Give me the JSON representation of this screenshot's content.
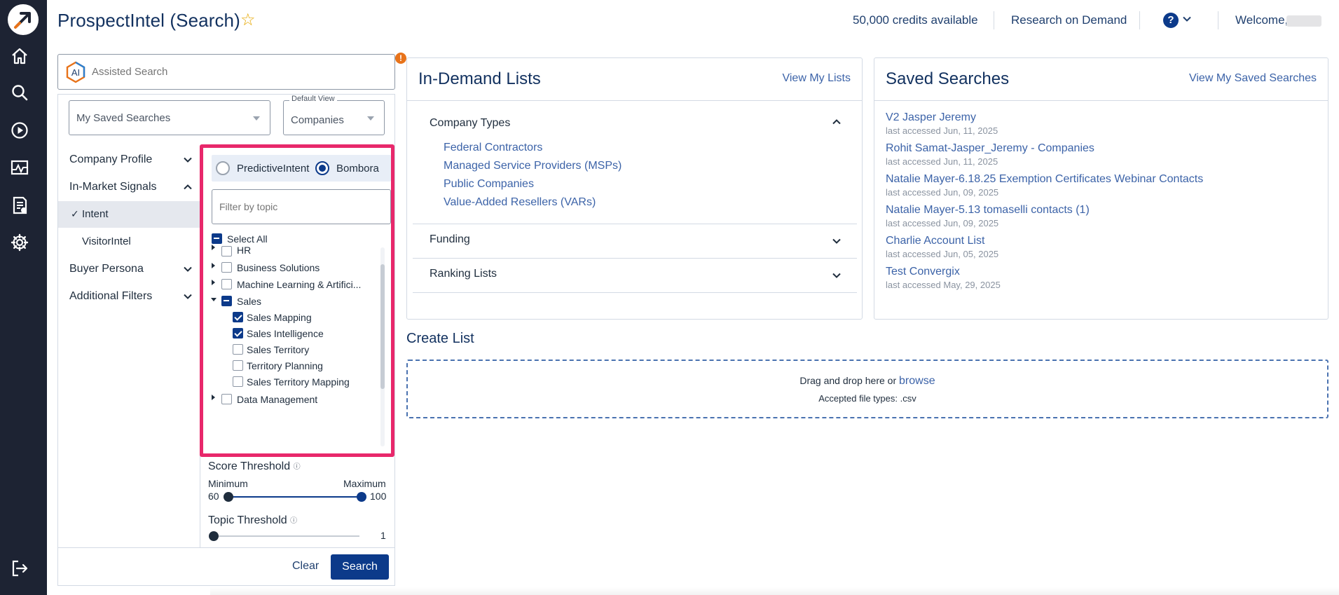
{
  "app": {
    "title": "ProspectIntel (Search)",
    "star_icon": "star-outline-icon"
  },
  "header": {
    "credits": "50,000 credits available",
    "research_on_demand": "Research on Demand",
    "help_glyph": "?",
    "welcome": "Welcome,"
  },
  "rail": {
    "items": [
      "home-icon",
      "search-icon",
      "play-icon",
      "analytics-icon",
      "report-icon",
      "settings-icon",
      "logout-icon"
    ]
  },
  "search": {
    "assisted_placeholder": "Assisted Search",
    "ai_badge": "AI",
    "saved_searches_select": "My Saved Searches",
    "default_view_legend": "Default View",
    "default_view_value": "Companies"
  },
  "nav": {
    "company_profile": "Company Profile",
    "in_market_signals": "In-Market Signals",
    "intent": "Intent",
    "visitor_intel": "VisitorIntel",
    "buyer_persona": "Buyer Persona",
    "additional_filters": "Additional Filters",
    "check_glyph": "✓"
  },
  "intent": {
    "radio_predictive": "PredictiveIntent",
    "radio_bombora": "Bombora",
    "selected_source": "Bombora",
    "filter_placeholder": "Filter by topic",
    "select_all": "Select All",
    "topics": {
      "hr": "HR",
      "business_solutions": "Business Solutions",
      "ml_ai": "Machine Learning & Artifici...",
      "sales": "Sales",
      "sales_mapping": "Sales Mapping",
      "sales_intelligence": "Sales Intelligence",
      "sales_territory": "Sales Territory",
      "territory_planning": "Territory Planning",
      "sales_territory_mapping": "Sales Territory Mapping",
      "data_management": "Data Management"
    }
  },
  "thresholds": {
    "score_title": "Score Threshold",
    "info_glyph": "ⓘ",
    "minimum_label": "Minimum",
    "maximum_label": "Maximum",
    "score_min": "60",
    "score_max": "100",
    "topic_title": "Topic Threshold",
    "topic_value": "1"
  },
  "actions": {
    "clear": "Clear",
    "search": "Search"
  },
  "in_demand": {
    "title": "In-Demand Lists",
    "link": "View My Lists",
    "company_types": "Company Types",
    "items": [
      "Federal Contractors",
      "Managed Service Providers (MSPs)",
      "Public Companies",
      "Value-Added Resellers (VARs)"
    ],
    "funding": "Funding",
    "ranking_lists": "Ranking Lists"
  },
  "saved_searches": {
    "title": "Saved Searches",
    "link": "View My Saved Searches",
    "items": [
      {
        "name": "V2 Jasper Jeremy",
        "accessed": "last accessed Jun, 11, 2025"
      },
      {
        "name": "Rohit Samat-Jasper_Jeremy - Companies",
        "accessed": "last accessed Jun, 11, 2025"
      },
      {
        "name": "Natalie Mayer-6.18.25 Exemption Certificates Webinar Contacts",
        "accessed": "last accessed Jun, 09, 2025"
      },
      {
        "name": "Natalie Mayer-5.13 tomaselli contacts (1)",
        "accessed": "last accessed Jun, 09, 2025"
      },
      {
        "name": "Charlie Account List",
        "accessed": "last accessed Jun, 05, 2025"
      },
      {
        "name": "Test Convergix",
        "accessed": "last accessed May, 29, 2025"
      }
    ]
  },
  "create_list": {
    "title": "Create List",
    "drop_text": "Drag and drop here or",
    "browse": "browse",
    "accepted": "Accepted file types: .csv"
  },
  "colors": {
    "rail_bg": "#1d2333",
    "brand_navy": "#0c3a8a",
    "link_blue": "#3c63a8",
    "highlight": "#e8286b",
    "warn": "#e8731a"
  }
}
